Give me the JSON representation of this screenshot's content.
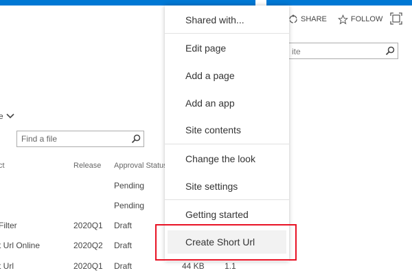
{
  "header": {
    "share_label": "SHARE",
    "follow_label": "FOLLOW"
  },
  "search": {
    "placeholder": "ite"
  },
  "library": {
    "view_label": "e",
    "find_placeholder": "Find a file",
    "columns": [
      "ct",
      "Release",
      "Approval Status"
    ],
    "rows": [
      {
        "name": "",
        "release": "",
        "status": "Pending"
      },
      {
        "name": "",
        "release": "",
        "status": "Pending"
      },
      {
        "name": "Filter",
        "release": "2020Q1",
        "status": "Draft"
      },
      {
        "name": "t Url Online",
        "release": "2020Q2",
        "status": "Draft"
      },
      {
        "name": "t Url",
        "release": "2020Q1",
        "status": "Draft",
        "size": "44 KB",
        "version": "1.1"
      }
    ]
  },
  "menu": {
    "items": [
      "Shared with...",
      "Edit page",
      "Add a page",
      "Add an app",
      "Site contents",
      "Change the look",
      "Site settings",
      "Getting started",
      "Create Short Url"
    ]
  },
  "colors": {
    "brand": "#0078d4",
    "highlight_border": "#e81123",
    "menu_hover": "#f2f2f2"
  }
}
